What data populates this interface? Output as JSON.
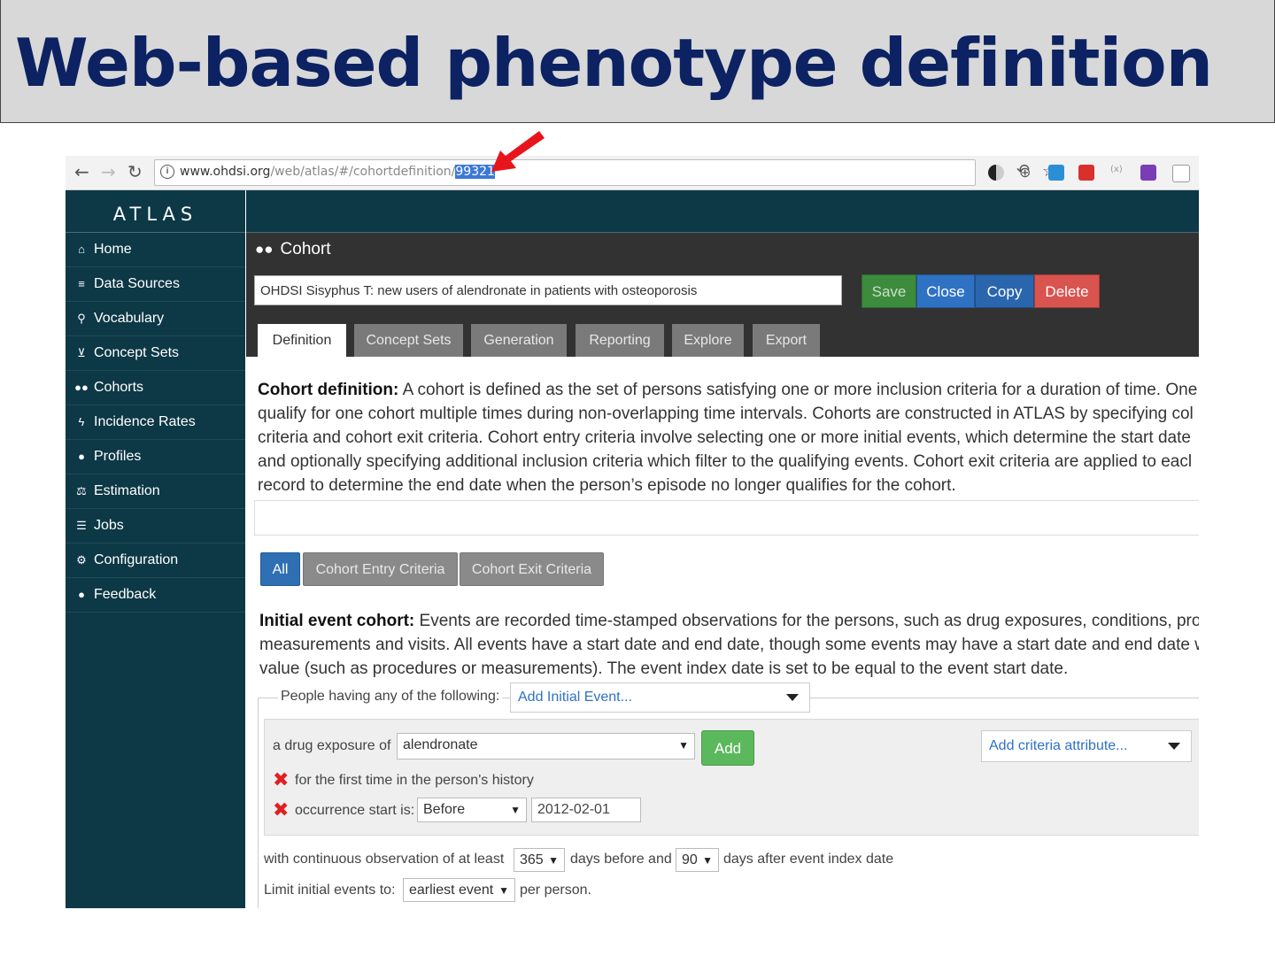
{
  "slide": {
    "title": "Web-based phenotype definition"
  },
  "browser": {
    "url_prefix": "www.ohdsi.org",
    "url_path": "/web/atlas/#/cohortdefinition/",
    "url_id": "99321",
    "info_icon": "i"
  },
  "sidebar": {
    "brand": "ATLAS",
    "items": [
      {
        "label": "Home",
        "icon": "home-icon"
      },
      {
        "label": "Data Sources",
        "icon": "database-icon"
      },
      {
        "label": "Vocabulary",
        "icon": "search-icon"
      },
      {
        "label": "Concept Sets",
        "icon": "cart-icon"
      },
      {
        "label": "Cohorts",
        "icon": "users-icon"
      },
      {
        "label": "Incidence Rates",
        "icon": "bolt-icon"
      },
      {
        "label": "Profiles",
        "icon": "user-icon"
      },
      {
        "label": "Estimation",
        "icon": "balance-scale-icon"
      },
      {
        "label": "Jobs",
        "icon": "tasks-icon"
      },
      {
        "label": "Configuration",
        "icon": "cogs-icon"
      },
      {
        "label": "Feedback",
        "icon": "comment-icon"
      }
    ]
  },
  "cohort": {
    "heading": "Cohort",
    "name": "OHDSI Sisyphus T:  new users of alendronate in patients with osteoporosis",
    "buttons": {
      "save": "Save",
      "close": "Close",
      "copy": "Copy",
      "delete": "Delete"
    },
    "tabs": [
      "Definition",
      "Concept Sets",
      "Generation",
      "Reporting",
      "Explore",
      "Export"
    ]
  },
  "definition": {
    "heading": "Cohort definition:",
    "lines": [
      " A cohort is defined as the set of persons satisfying one or more inclusion criteria for a duration of time. One",
      "qualify for one cohort multiple times during non-overlapping time intervals. Cohorts are constructed in ATLAS by specifying col",
      "criteria and cohort exit criteria. Cohort entry criteria involve selecting one or more initial events, which determine the start date",
      "and optionally specifying additional inclusion criteria which filter to the qualifying events. Cohort exit criteria are applied to eacl",
      "record to determine the end date when the person’s episode no longer qualifies for the cohort."
    ]
  },
  "filters": {
    "all": "All",
    "entry": "Cohort Entry Criteria",
    "exit": "Cohort Exit Criteria"
  },
  "initial_event": {
    "heading": "Initial event cohort:",
    "lines": [
      " Events are recorded time-stamped observations for the persons, such as drug exposures, conditions, proc",
      "measurements and visits. All events have a start date and end date, though some events may have a start date and end date w",
      "value (such as procedures or measurements). The event index date is set to be equal to the event start date."
    ],
    "people_label": "People having any of the following:",
    "add_initial_event": "Add Initial Event..."
  },
  "criteria": {
    "drug_label": "a drug exposure of",
    "drug_value": "alendronate",
    "add_button": "Add",
    "add_attribute": "Add criteria attribute...",
    "first_time": "for the first time in the person's history",
    "occurrence_label": "occurrence start is:",
    "occurrence_op": "Before",
    "occurrence_date": "2012-02-01"
  },
  "observation": {
    "prefix": "with continuous observation of at least",
    "before_days": "365",
    "middle": "days before and",
    "after_days": "90",
    "suffix": "days after event index date",
    "limit_label": "Limit initial events to:",
    "limit_value": "earliest event",
    "limit_suffix": "per person."
  },
  "colors": {
    "title": "#0c2262",
    "sidebar": "#0d3846",
    "save": "#3d8b3d",
    "close": "#2f72c4",
    "copy": "#2a66ad",
    "delete": "#d9534f",
    "arrow": "#e8141c"
  }
}
